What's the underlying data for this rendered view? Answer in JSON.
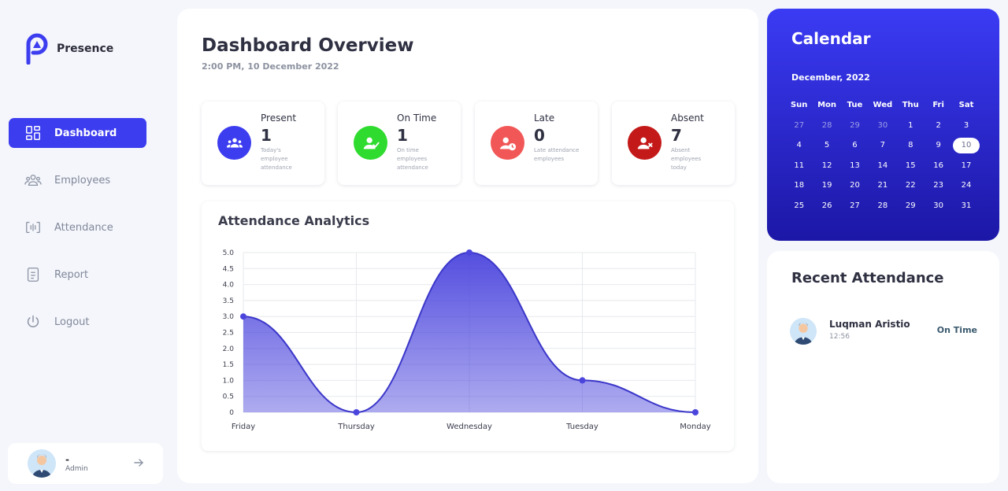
{
  "brand": {
    "name": "Presence"
  },
  "nav": [
    {
      "label": "Dashboard",
      "icon": "dashboard-icon",
      "active": true
    },
    {
      "label": "Employees",
      "icon": "employees-icon",
      "active": false
    },
    {
      "label": "Attendance",
      "icon": "attendance-icon",
      "active": false
    },
    {
      "label": "Report",
      "icon": "report-icon",
      "active": false
    },
    {
      "label": "Logout",
      "icon": "logout-icon",
      "active": false
    }
  ],
  "user": {
    "name": "-",
    "role": "Admin"
  },
  "header": {
    "title": "Dashboard Overview",
    "datetime": "2:00 PM, 10 December 2022"
  },
  "stats": [
    {
      "label": "Present",
      "value": "1",
      "desc": "Today's employee attendance",
      "color": "#3d3df0"
    },
    {
      "label": "On Time",
      "value": "1",
      "desc": "On time employees attendance",
      "color": "#2edb2e"
    },
    {
      "label": "Late",
      "value": "0",
      "desc": "Late attendance employees",
      "color": "#f25757"
    },
    {
      "label": "Absent",
      "value": "7",
      "desc": "Absent employees today",
      "color": "#c41919"
    }
  ],
  "analytics": {
    "title": "Attendance Analytics"
  },
  "chart_data": {
    "type": "area",
    "categories": [
      "Friday",
      "Thursday",
      "Wednesday",
      "Tuesday",
      "Monday"
    ],
    "values": [
      3,
      0,
      5,
      1,
      0
    ],
    "ylim": [
      0,
      5
    ],
    "yticks": [
      "0",
      "0.5",
      "1.0",
      "1.5",
      "2.0",
      "2.5",
      "3.0",
      "3.5",
      "4.0",
      "4.5",
      "5.0"
    ],
    "color": "#4b45dd",
    "grid": true
  },
  "calendar": {
    "title": "Calendar",
    "month": "December, 2022",
    "weekdays": [
      "Sun",
      "Mon",
      "Tue",
      "Wed",
      "Thu",
      "Fri",
      "Sat"
    ],
    "weeks": [
      [
        {
          "d": "27",
          "m": true
        },
        {
          "d": "28",
          "m": true
        },
        {
          "d": "29",
          "m": true
        },
        {
          "d": "30",
          "m": true
        },
        {
          "d": "1"
        },
        {
          "d": "2"
        },
        {
          "d": "3"
        }
      ],
      [
        {
          "d": "4"
        },
        {
          "d": "5"
        },
        {
          "d": "6"
        },
        {
          "d": "7"
        },
        {
          "d": "8"
        },
        {
          "d": "9"
        },
        {
          "d": "10",
          "t": true
        }
      ],
      [
        {
          "d": "11"
        },
        {
          "d": "12"
        },
        {
          "d": "13"
        },
        {
          "d": "14"
        },
        {
          "d": "15"
        },
        {
          "d": "16"
        },
        {
          "d": "17"
        }
      ],
      [
        {
          "d": "18"
        },
        {
          "d": "19"
        },
        {
          "d": "20"
        },
        {
          "d": "21"
        },
        {
          "d": "22"
        },
        {
          "d": "23"
        },
        {
          "d": "24"
        }
      ],
      [
        {
          "d": "25"
        },
        {
          "d": "26"
        },
        {
          "d": "27"
        },
        {
          "d": "28"
        },
        {
          "d": "29"
        },
        {
          "d": "30"
        },
        {
          "d": "31"
        }
      ]
    ]
  },
  "recent": {
    "title": "Recent Attendance",
    "items": [
      {
        "name": "Luqman Aristio",
        "time": "12:56",
        "status": "On Time"
      }
    ]
  }
}
